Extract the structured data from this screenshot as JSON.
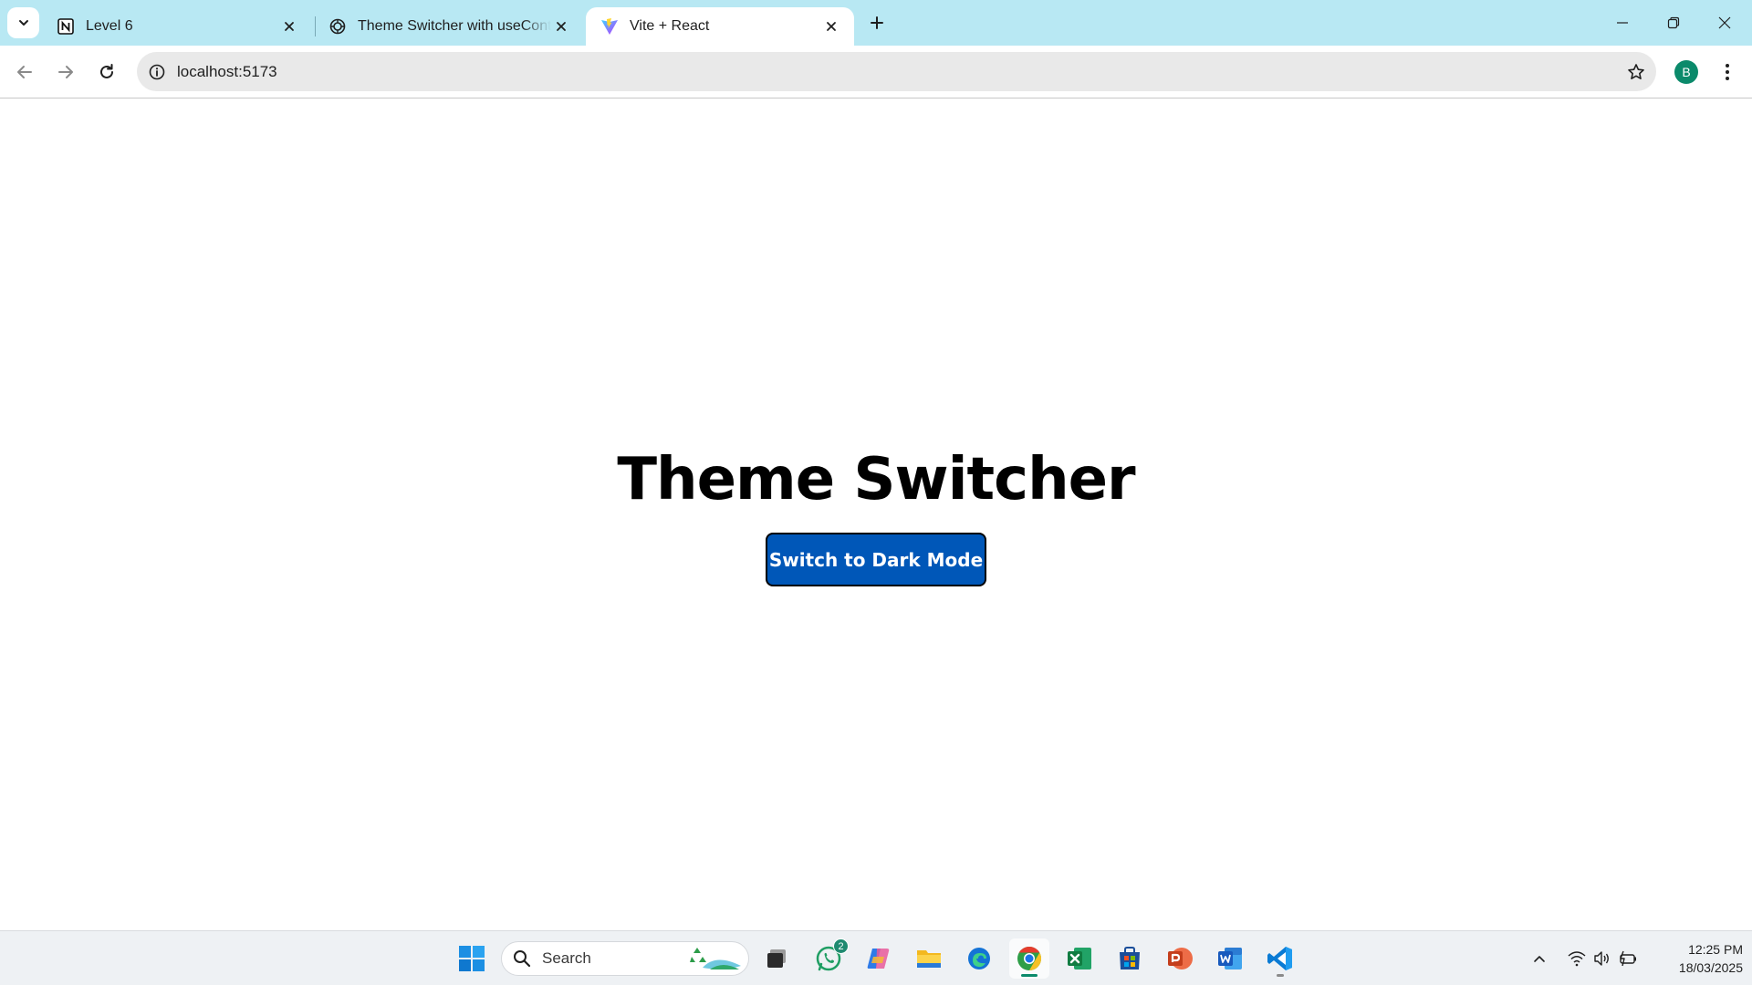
{
  "browser": {
    "tabs": [
      {
        "title": "Level 6",
        "favicon": "notion-icon",
        "active": false
      },
      {
        "title": "Theme Switcher with useContext",
        "favicon": "chatgpt-icon",
        "active": false
      },
      {
        "title": "Vite + React",
        "favicon": "vite-icon",
        "active": true
      }
    ],
    "address": {
      "url": "localhost:5173"
    },
    "profile_initial": "B"
  },
  "page": {
    "heading": "Theme Switcher",
    "button_label": "Switch to Dark Mode",
    "colors": {
      "button_bg": "#0057b8",
      "button_text": "#ffffff",
      "heading": "#000000"
    }
  },
  "taskbar": {
    "search_label": "Search",
    "whatsapp_badge": "2",
    "apps": [
      "start-icon",
      "task-view-icon",
      "whatsapp-icon",
      "copilot-icon",
      "file-explorer-icon",
      "edge-icon",
      "chrome-icon",
      "excel-icon",
      "store-icon",
      "powerpoint-icon",
      "word-icon",
      "vscode-icon"
    ],
    "clock": {
      "time": "12:25 PM",
      "date": "18/03/2025"
    }
  },
  "colors": {
    "tabstrip_bg": "#b8e8f3",
    "accent": "#0057b8"
  }
}
